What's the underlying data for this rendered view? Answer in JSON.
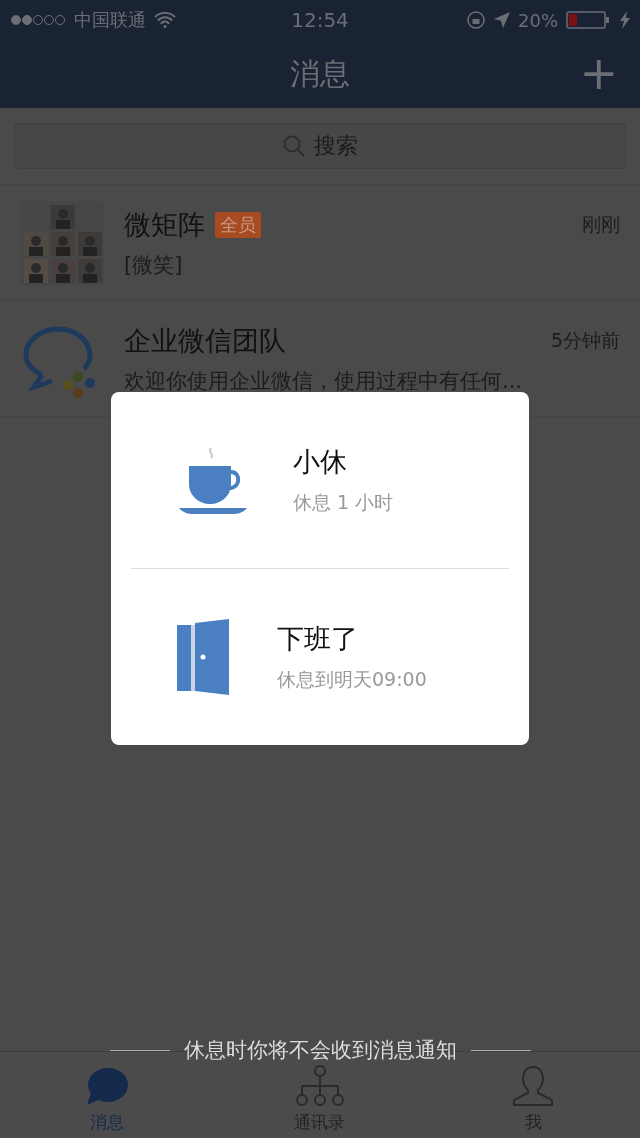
{
  "status_bar": {
    "carrier": "中国联通",
    "time": "12:54",
    "battery": "20%"
  },
  "nav": {
    "title": "消息",
    "add_symbol": "+"
  },
  "search": {
    "placeholder": "搜索"
  },
  "chats": [
    {
      "name": "微矩阵",
      "badge": "全员",
      "preview": "[微笑]",
      "time": "刚刚",
      "kind": "group"
    },
    {
      "name": "企业微信团队",
      "preview": "欢迎你使用企业微信，使用过程中有任何...",
      "time": "5分钟前",
      "kind": "logo"
    }
  ],
  "rest_menu": {
    "options": [
      {
        "kind": "cup",
        "title": "小休",
        "subtitle": "休息 1 小时"
      },
      {
        "kind": "door",
        "title": "下班了",
        "subtitle": "休息到明天09:00"
      }
    ],
    "note": "休息时你将不会收到消息通知"
  },
  "tabs": [
    {
      "label": "消息",
      "kind": "chat",
      "selected": true
    },
    {
      "label": "通讯录",
      "kind": "org",
      "selected": false
    },
    {
      "label": "我",
      "kind": "person",
      "selected": false
    }
  ]
}
